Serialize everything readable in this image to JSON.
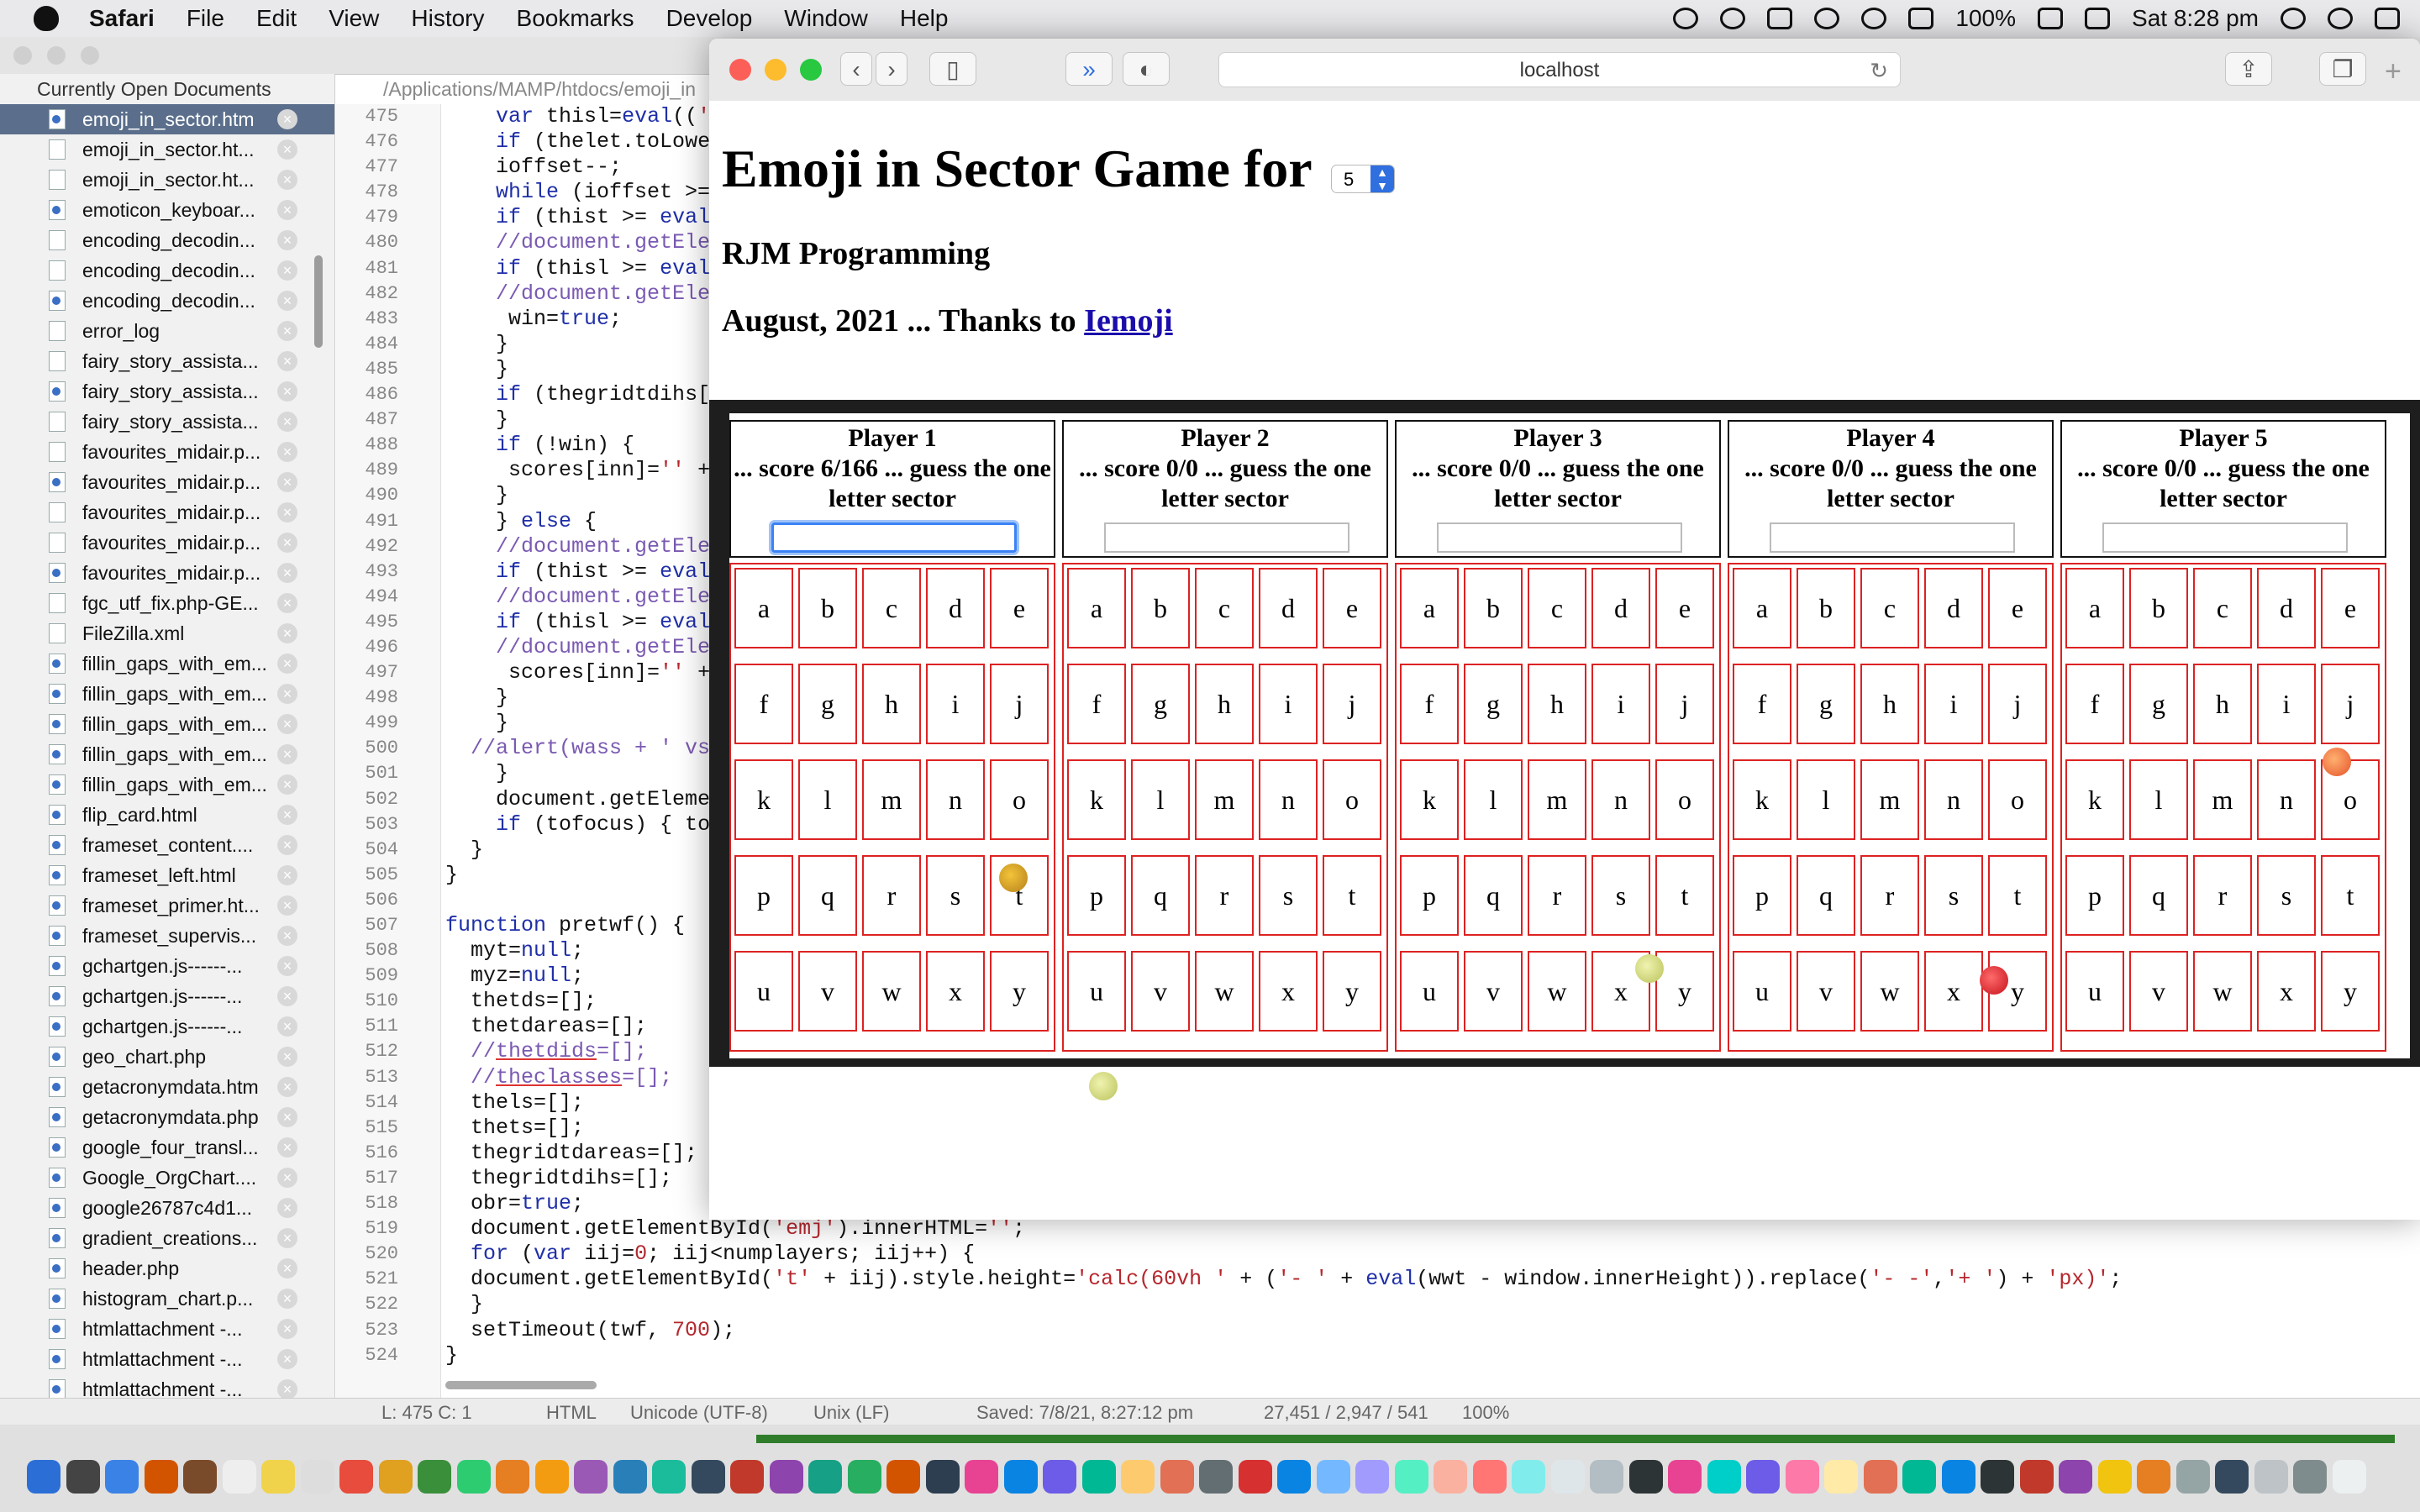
{
  "menubar": {
    "app": "Safari",
    "items": [
      "File",
      "Edit",
      "View",
      "History",
      "Bookmarks",
      "Develop",
      "Window",
      "Help"
    ],
    "battery": "100%",
    "clock": "Sat 8:28 pm"
  },
  "editor": {
    "sidebar_title": "Currently Open Documents",
    "path": "/Applications/MAMP/htdocs/emoji_in",
    "files": [
      "emoji_in_sector.htm",
      "emoji_in_sector.ht...",
      "emoji_in_sector.ht...",
      "emoticon_keyboar...",
      "encoding_decodin...",
      "encoding_decodin...",
      "encoding_decodin...",
      "error_log",
      "fairy_story_assista...",
      "fairy_story_assista...",
      "fairy_story_assista...",
      "favourites_midair.p...",
      "favourites_midair.p...",
      "favourites_midair.p...",
      "favourites_midair.p...",
      "favourites_midair.p...",
      "fgc_utf_fix.php-GE...",
      "FileZilla.xml",
      "fillin_gaps_with_em...",
      "fillin_gaps_with_em...",
      "fillin_gaps_with_em...",
      "fillin_gaps_with_em...",
      "fillin_gaps_with_em...",
      "flip_card.html",
      "frameset_content....",
      "frameset_left.html",
      "frameset_primer.ht...",
      "frameset_supervis...",
      "gchartgen.js------...",
      "gchartgen.js------...",
      "gchartgen.js------...",
      "geo_chart.php",
      "getacronymdata.htm",
      "getacronymdata.php",
      "google_four_transl...",
      "Google_OrgChart....",
      "google26787c4d1...",
      "gradient_creations...",
      "header.php",
      "histogram_chart.p...",
      "htmlattachment -...",
      "htmlattachment -...",
      "htmlattachment -..."
    ],
    "line_numbers": [
      "475",
      "476",
      "477",
      "478",
      "479",
      "480",
      "481",
      "482",
      "483",
      "484",
      "485",
      "486",
      "487",
      "488",
      "489",
      "490",
      "491",
      "492",
      "493",
      "494",
      "495",
      "496",
      "497",
      "498",
      "499",
      "500",
      "501",
      "502",
      "503",
      "504",
      "505",
      "506",
      "507",
      "508",
      "509",
      "510",
      "511",
      "512",
      "513",
      "514",
      "515",
      "516",
      "517",
      "518",
      "519",
      "520",
      "521",
      "522",
      "523",
      "524"
    ],
    "status": {
      "position": "L: 475 C: 1",
      "language": "HTML",
      "encoding": "Unicode (UTF-8)",
      "line_endings": "Unix (LF)",
      "saved": "Saved: 7/8/21, 8:27:12 pm",
      "counts": "27,451 / 2,947 / 541",
      "zoom": "100%"
    }
  },
  "browser": {
    "url": "localhost",
    "page": {
      "title": "Emoji in Sector Game for",
      "players_selected": "5",
      "subtitle": "RJM Programming",
      "credit_prefix": "August, 2021 ... Thanks to",
      "credit_link": "Iemoji",
      "players": [
        {
          "name": "Player 1",
          "status": "... score 6/166 ... guess the one letter sector"
        },
        {
          "name": "Player 2",
          "status": "... score 0/0 ... guess the one letter sector"
        },
        {
          "name": "Player 3",
          "status": "... score 0/0 ... guess the one letter sector"
        },
        {
          "name": "Player 4",
          "status": "... score 0/0 ... guess the one letter sector"
        },
        {
          "name": "Player 5",
          "status": "... score 0/0 ... guess the one letter sector"
        }
      ],
      "letters": [
        "a",
        "b",
        "c",
        "d",
        "e",
        "f",
        "g",
        "h",
        "i",
        "j",
        "k",
        "l",
        "m",
        "n",
        "o",
        "p",
        "q",
        "r",
        "s",
        "t",
        "u",
        "v",
        "w",
        "x",
        "y"
      ]
    }
  },
  "colors": {
    "grid_border": "#d22222",
    "link": "#1a0dab",
    "focus": "#3b82f6",
    "sidebar_selection": "#5b6f8c"
  }
}
